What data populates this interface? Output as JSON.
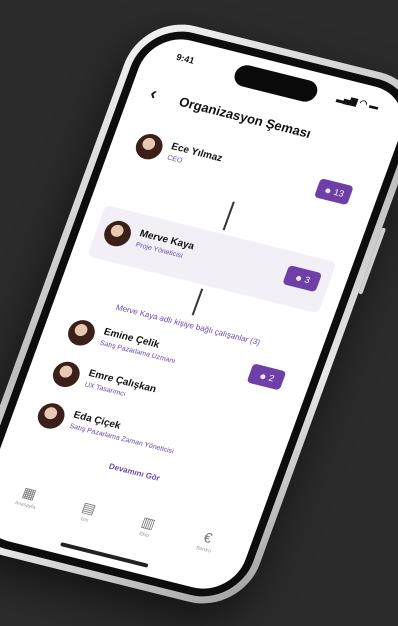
{
  "status": {
    "time": "9:41",
    "icons": "▂▄▆ ◠ ▬"
  },
  "header": {
    "back": "‹",
    "title": "Organizasyon Şeması"
  },
  "top": {
    "name": "Ece Yılmaz",
    "role": "CEO",
    "badge": "13"
  },
  "selected": {
    "name": "Merve Kaya",
    "role": "Proje Yöneticisi",
    "badge": "3"
  },
  "sub_label": "Merve Kaya adlı kişiye bağlı çalışanlar (3)",
  "reports": [
    {
      "name": "Emine Çelik",
      "role": "Satış Pazarlama Uzmanı",
      "badge": "2"
    },
    {
      "name": "Emre Çalışkan",
      "role": "UX Tasarımcı",
      "badge": ""
    },
    {
      "name": "Eda Çiçek",
      "role": "Satış Pazarlama Zaman Yöneticisi",
      "badge": ""
    }
  ],
  "more": "Devamını Gör",
  "tabs": [
    {
      "icon": "grid-icon",
      "glyph": "▦",
      "label": "Anasayfa"
    },
    {
      "icon": "calendar-icon",
      "glyph": "▤",
      "label": "İzin"
    },
    {
      "icon": "people-icon",
      "glyph": "▥",
      "label": "Ekip"
    },
    {
      "icon": "currency-icon",
      "glyph": "€",
      "label": "Bordro"
    }
  ],
  "colors": {
    "accent": "#6e3fa8",
    "background": "#2b2b2b"
  }
}
